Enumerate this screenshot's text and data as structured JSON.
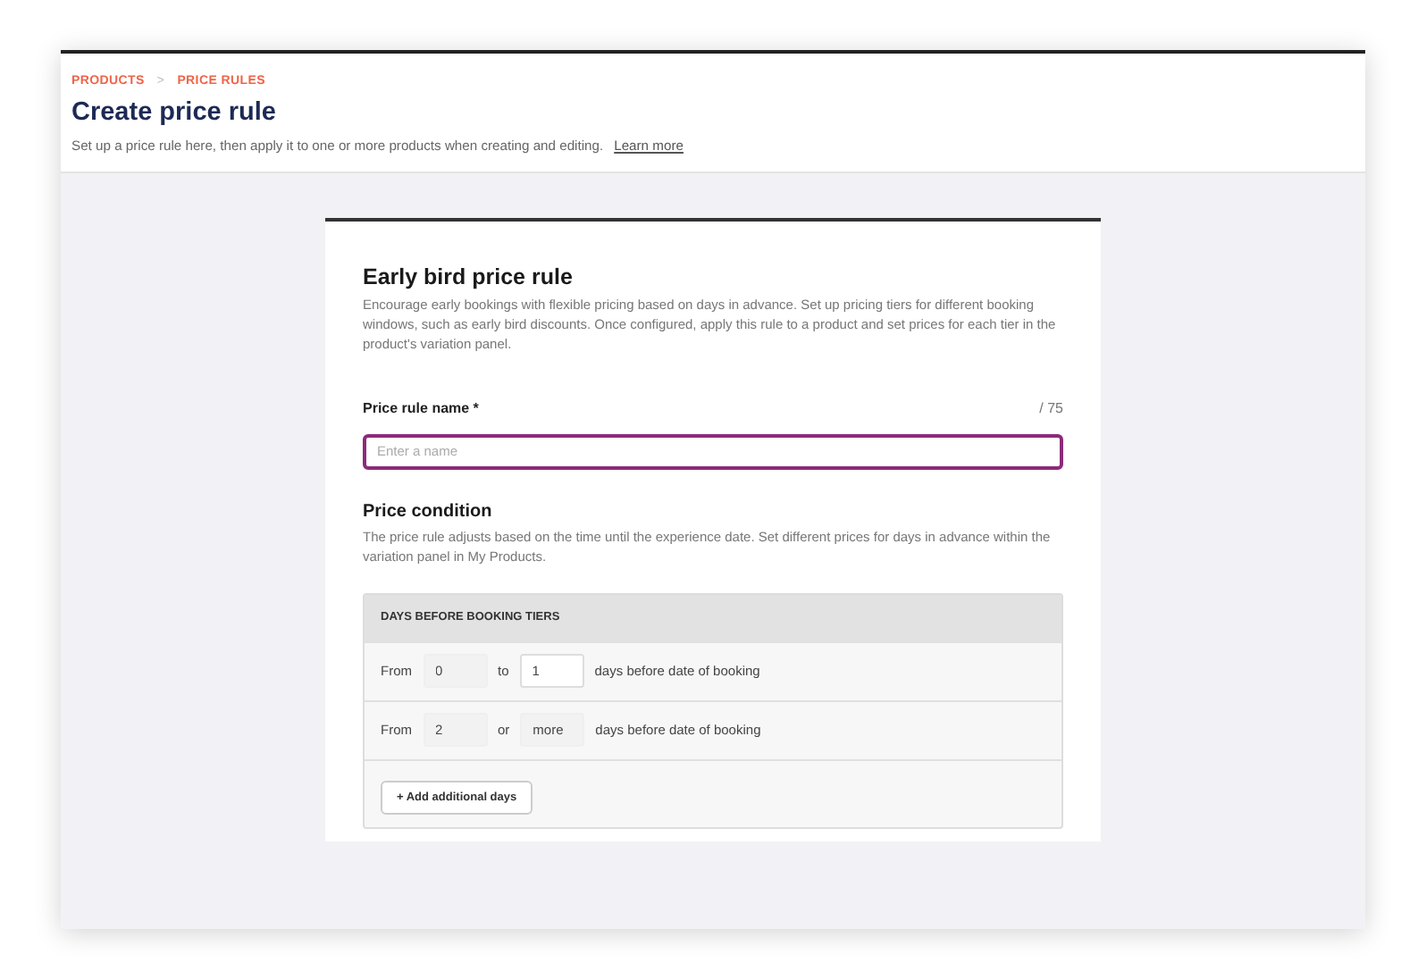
{
  "breadcrumb": [
    {
      "label": "PRODUCTS"
    },
    {
      "label": "PRICE RULES"
    }
  ],
  "breadcrumb_separator": ">",
  "title": "Create price rule",
  "subtitle": "Set up a price rule here, then apply it to one or more products when creating and editing.",
  "learn_more": "Learn more",
  "form": {
    "title": "Early bird price rule",
    "description": "Encourage early bookings with flexible pricing based on days in advance. Set up pricing tiers for different booking windows, such as early bird discounts. Once configured, apply this rule to a product and set prices for each tier in the product's variation panel.",
    "name_field": {
      "label": "Price rule name *",
      "counter": "/ 75",
      "placeholder": "Enter a name"
    },
    "condition_title": "Price condition",
    "condition_description": "The price rule adjusts based on the time until the experience date. Set different prices for days in advance within the variation panel in My Products.",
    "tiers": {
      "heading": "DAYS BEFORE BOOKING TIERS",
      "rows": [
        {
          "from_label": "From",
          "from": {
            "value": "0",
            "disabled": true
          },
          "joiner": "to",
          "to": {
            "value": "1",
            "disabled": false
          },
          "suffix": "days before date of booking"
        },
        {
          "from_label": "From",
          "from": {
            "value": "2",
            "disabled": true
          },
          "joiner": "or",
          "to": {
            "value": "more",
            "disabled": true
          },
          "suffix": "days before date of booking"
        }
      ],
      "add_button": {
        "icon": "+",
        "label": "Add additional days"
      }
    }
  }
}
